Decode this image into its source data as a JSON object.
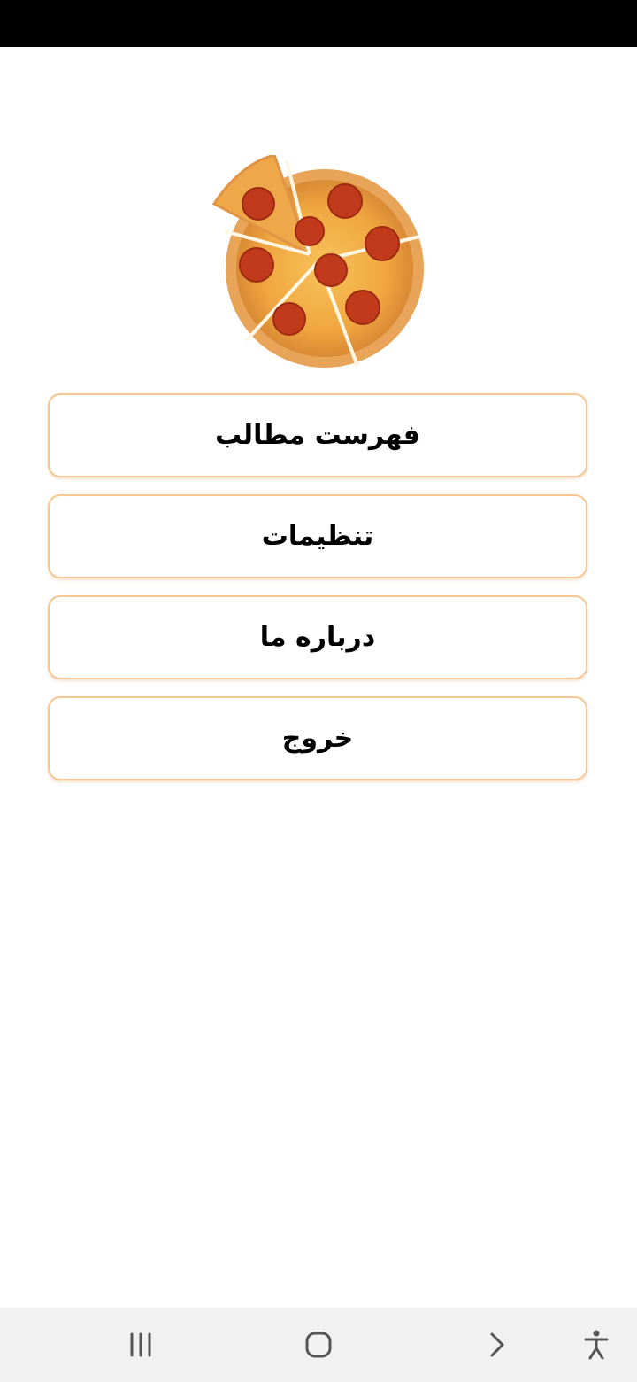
{
  "menu": {
    "items": [
      {
        "label": "فهرست مطالب"
      },
      {
        "label": "تنظیمات"
      },
      {
        "label": "درباره ما"
      },
      {
        "label": "خروج"
      }
    ]
  },
  "icons": {
    "logo": "pizza-image",
    "nav_recent": "recent-apps-icon",
    "nav_home": "home-icon",
    "nav_back": "back-icon",
    "nav_accessibility": "accessibility-icon"
  },
  "colors": {
    "button_border": "#f6c694",
    "status_bar": "#000000",
    "nav_bar": "#f1f1f1"
  }
}
